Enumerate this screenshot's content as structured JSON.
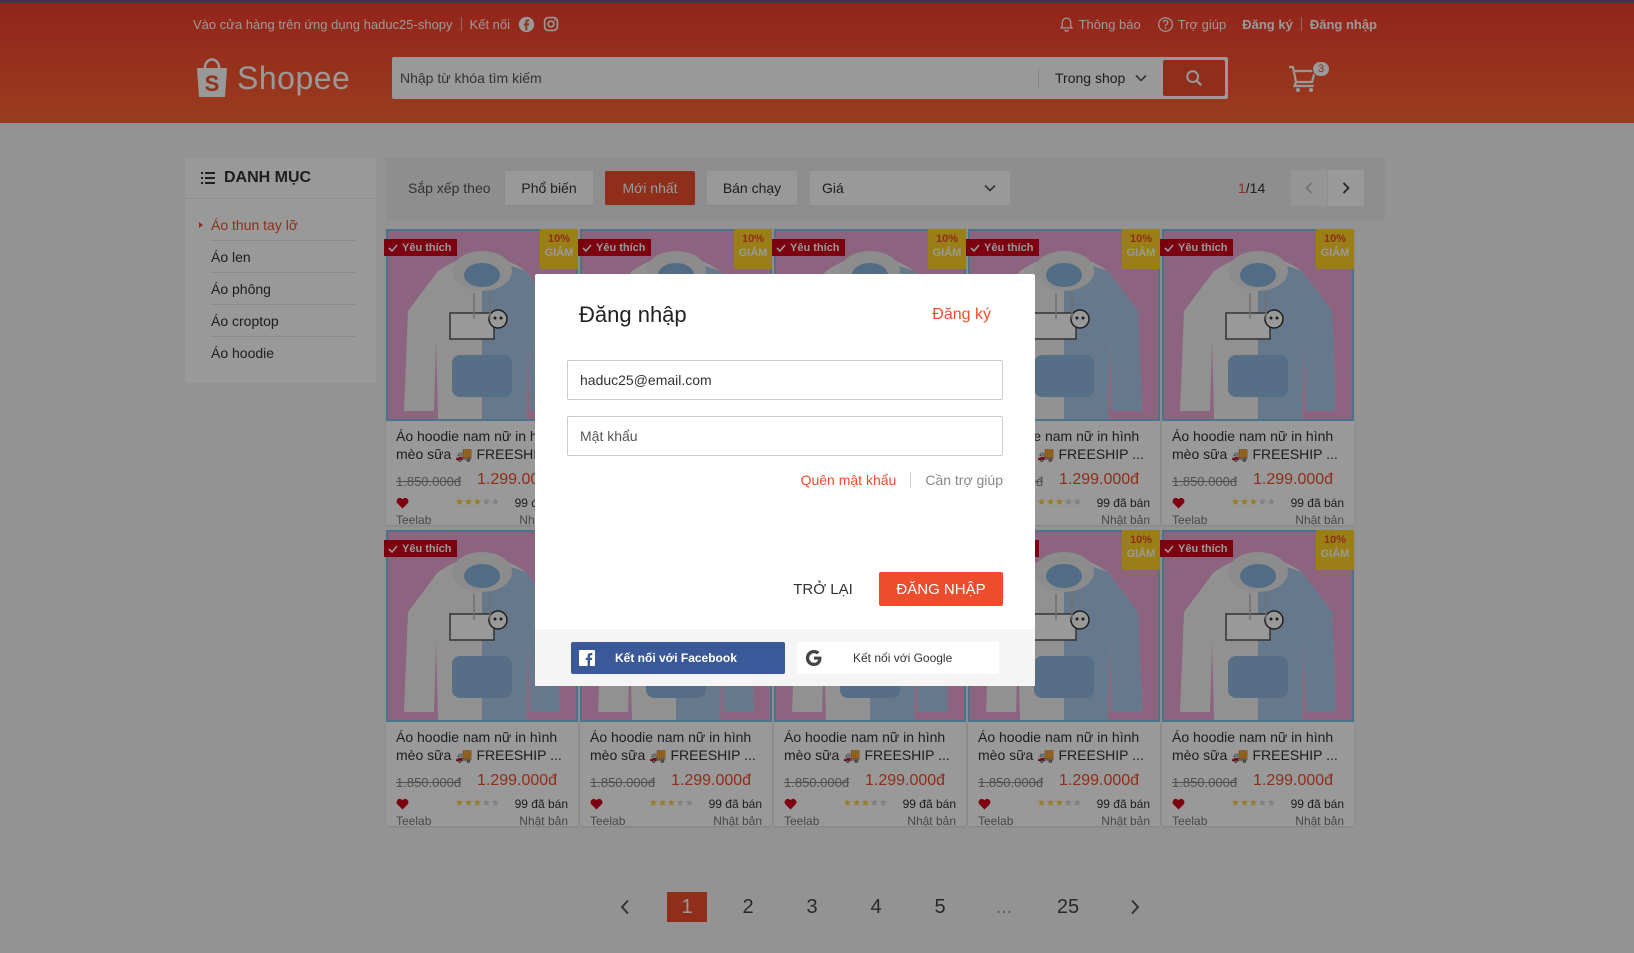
{
  "topbar": {
    "download_text": "Vào cửa hàng trên ứng dụng haduc25-shopy",
    "connect_label": "Kết nối",
    "notifications": "Thông báo",
    "help": "Trợ giúp",
    "register": "Đăng ký",
    "login": "Đăng nhập"
  },
  "logo": {
    "text": "Shopee"
  },
  "search": {
    "placeholder": "Nhập từ khóa tìm kiếm",
    "scope": "Trong shop"
  },
  "cart": {
    "count": "3"
  },
  "sidebar": {
    "title": "DANH MỤC",
    "items": [
      {
        "label": "Áo thun tay lỡ"
      },
      {
        "label": "Áo len"
      },
      {
        "label": "Áo phông"
      },
      {
        "label": "Áo croptop"
      },
      {
        "label": "Áo hoodie"
      }
    ]
  },
  "sortbar": {
    "label": "Sắp xếp theo",
    "options": [
      "Phổ biến",
      "Mới nhất",
      "Bán chạy"
    ],
    "price_select": "Giá",
    "page_current": "1",
    "page_total": "/14"
  },
  "product": {
    "fav_badge": "Yêu thích",
    "discount_pct": "10%",
    "discount_label": "GIẢM",
    "name": "Áo hoodie nam nữ in hình mèo sữa 🚚 FREESHIP ...",
    "old_price": "1.850.000đ",
    "new_price": "1.299.000đ",
    "rating": 3,
    "sold": "99 đã bán",
    "shop": "Teelab",
    "origin": "Nhật bản"
  },
  "pagination": {
    "pages": [
      "1",
      "2",
      "3",
      "4",
      "5",
      "...",
      "25"
    ]
  },
  "modal": {
    "title": "Đăng nhập",
    "register_link": "Đăng ký",
    "email_value": "haduc25@email.com",
    "password_placeholder": "Mật khẩu",
    "forgot": "Quên mật khẩu",
    "help": "Cần trợ giúp",
    "back": "TRỞ LẠI",
    "submit": "ĐĂNG NHẬP",
    "facebook": "Kết nối với Facebook",
    "google": "Kết nối với Google"
  },
  "colors": {
    "primary": "#ee4d2d",
    "facebook": "#3b5998",
    "overlay": "rgba(0,0,0,0.4)"
  }
}
